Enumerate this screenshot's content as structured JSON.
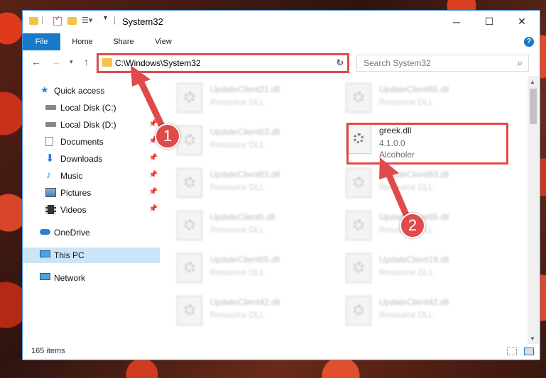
{
  "window": {
    "title": "System32",
    "minimize": "─",
    "maximize": "☐",
    "close": "✕"
  },
  "ribbon": {
    "tabs": [
      "File",
      "Home",
      "Share",
      "View"
    ],
    "help": "?"
  },
  "nav": {
    "address": "C:\\Windows\\System32",
    "search_placeholder": "Search System32"
  },
  "sidebar": {
    "items": [
      {
        "label": "Quick access"
      },
      {
        "label": "Local Disk (C:)"
      },
      {
        "label": "Local Disk (D:)"
      },
      {
        "label": "Documents"
      },
      {
        "label": "Downloads"
      },
      {
        "label": "Music"
      },
      {
        "label": "Pictures"
      },
      {
        "label": "Videos"
      },
      {
        "label": "OneDrive"
      },
      {
        "label": "This PC"
      },
      {
        "label": "Network"
      }
    ]
  },
  "files": [
    {
      "name": "UpdateClient21.dll",
      "desc": "Resource DLL"
    },
    {
      "name": "UpdateClient65.dll",
      "desc": "Resource DLL"
    },
    {
      "name": "UpdateClient63.dll",
      "desc": "Resource DLL"
    },
    {
      "name": "greek.dll",
      "version": "4.1.0.0",
      "company": "Alcoholer"
    },
    {
      "name": "UpdateClient63.dll",
      "desc": "Resource DLL"
    },
    {
      "name": "UpdateClient63.dll",
      "desc": "Resource DLL"
    },
    {
      "name": "UpdateClient5.dll",
      "desc": "Resource DLL"
    },
    {
      "name": "UpdateClient65.dll",
      "desc": "Resource DLL"
    },
    {
      "name": "UpdateClient65.dll",
      "desc": "Resource DLL"
    },
    {
      "name": "UpdateClient19.dll",
      "desc": "Resource DLL"
    },
    {
      "name": "UpdateClient42.dll",
      "desc": "Resource DLL"
    },
    {
      "name": "UpdateClient42.dll",
      "desc": "Resource DLL"
    }
  ],
  "status": {
    "item_count": "165 items"
  },
  "annotations": {
    "step1": "1",
    "step2": "2",
    "color": "#e04a4a"
  },
  "colors": {
    "accent": "#1979ca",
    "selection": "#cce4f7",
    "highlight_box": "#e04a4a"
  }
}
